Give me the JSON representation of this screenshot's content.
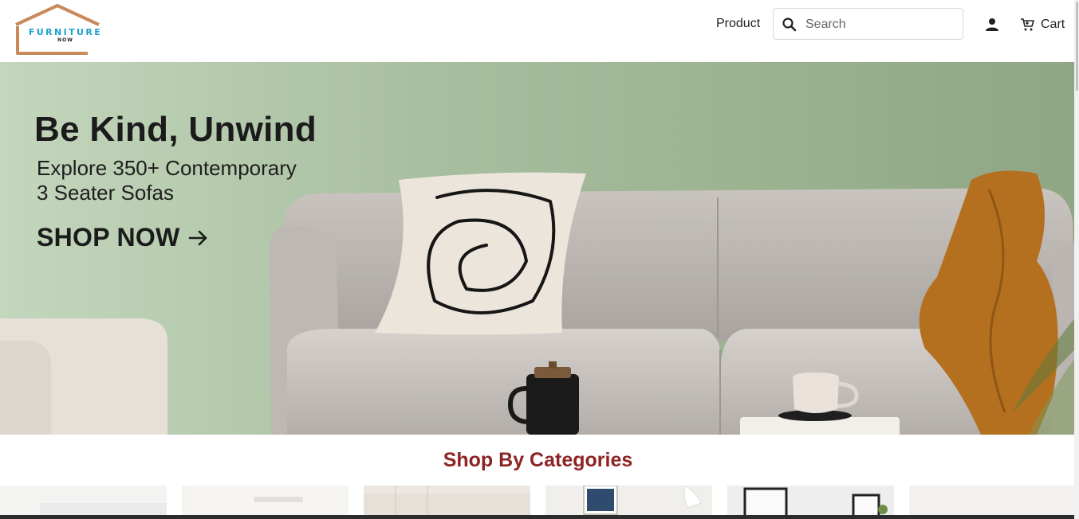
{
  "header": {
    "logo": {
      "brand": "FURNITURE",
      "sub": "NOW",
      "icon": "house-roof-logo",
      "roof_color": "#c88a5a",
      "text_color": "#1aa0cf"
    },
    "nav_product_label": "Product",
    "search": {
      "placeholder": "Search",
      "value": ""
    },
    "icons": {
      "search": "search-icon",
      "user": "user-icon",
      "cart": "cart-icon"
    },
    "cart_label": "Cart"
  },
  "hero": {
    "title": "Be Kind, Unwind",
    "line1": "Explore 350+ Contemporary",
    "line2": "3 Seater Sofas",
    "cta_label": "SHOP NOW",
    "cta_icon": "arrow-right-icon"
  },
  "categories": {
    "title": "Shop By Categories",
    "title_color": "#8e2424"
  }
}
